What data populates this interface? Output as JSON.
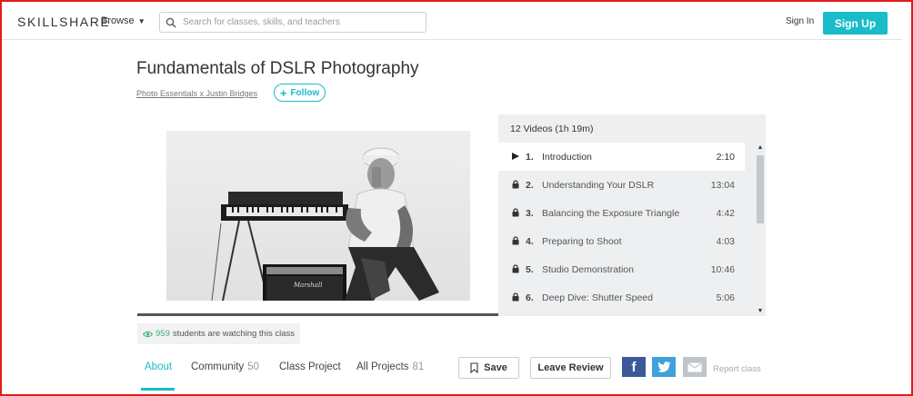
{
  "header": {
    "logo": "SKILLSHARE",
    "browse_label": "Browse",
    "search_placeholder": "Search for classes, skills, and teachers",
    "signin_label": "Sign In",
    "signup_label": "Sign Up"
  },
  "course": {
    "title": "Fundamentals of DSLR Photography",
    "author": "Photo Essentials x Justin Bridges",
    "follow_label": "Follow"
  },
  "playlist": {
    "header": "12 Videos (1h 19m)",
    "items": [
      {
        "num": "1.",
        "title": "Introduction",
        "duration": "2:10",
        "state": "playing"
      },
      {
        "num": "2.",
        "title": "Understanding Your DSLR",
        "duration": "13:04",
        "state": "locked"
      },
      {
        "num": "3.",
        "title": "Balancing the Exposure Triangle",
        "duration": "4:42",
        "state": "locked"
      },
      {
        "num": "4.",
        "title": "Preparing to Shoot",
        "duration": "4:03",
        "state": "locked"
      },
      {
        "num": "5.",
        "title": "Studio Demonstration",
        "duration": "10:46",
        "state": "locked"
      },
      {
        "num": "6.",
        "title": "Deep Dive: Shutter Speed",
        "duration": "5:06",
        "state": "locked"
      }
    ]
  },
  "watching": {
    "count": "959",
    "text": "students are watching this class"
  },
  "tabs": {
    "about": "About",
    "community": "Community",
    "community_count": "50",
    "class_project": "Class Project",
    "all_projects": "All Projects",
    "all_projects_count": "81"
  },
  "actions": {
    "save": "Save",
    "leave_review": "Leave Review",
    "report": "Report class"
  },
  "colors": {
    "accent": "#19bcc9",
    "facebook": "#3b5998",
    "twitter": "#3fa0dc",
    "email": "#bfc5ca",
    "watching_green": "#3cb37a",
    "frame": "#e31b1b"
  }
}
